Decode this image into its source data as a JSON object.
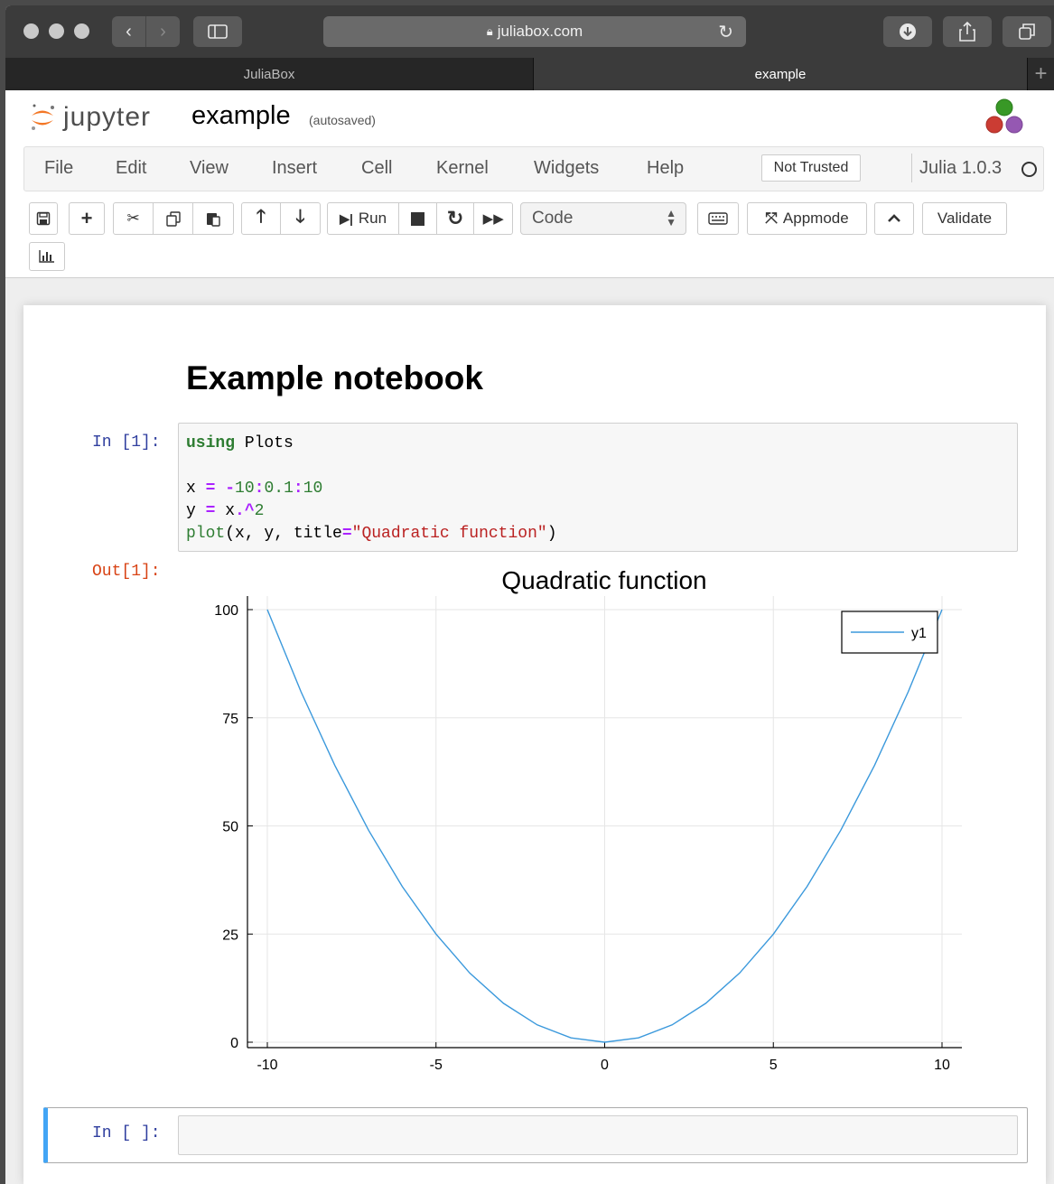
{
  "browser": {
    "address": "juliabox.com",
    "tabs": [
      {
        "label": "JuliaBox",
        "active": false
      },
      {
        "label": "example",
        "active": true
      }
    ]
  },
  "jupyter": {
    "logo_text": "jupyter",
    "notebook_name": "example",
    "autosave_status": "(autosaved)",
    "menu": [
      "File",
      "Edit",
      "View",
      "Insert",
      "Cell",
      "Kernel",
      "Widgets",
      "Help"
    ],
    "trust_status": "Not Trusted",
    "kernel_name": "Julia 1.0.3",
    "toolbar": {
      "run_label": "Run",
      "cell_type": "Code",
      "appmode_label": "Appmode",
      "validate_label": "Validate"
    }
  },
  "notebook": {
    "heading": "Example notebook",
    "cell1": {
      "prompt_in": "In [1]:",
      "prompt_out": "Out[1]:",
      "code_lines": [
        "using Plots",
        "",
        "x = -10:0.1:10",
        "y = x.^2",
        "plot(x, y, title=\"Quadratic function\")"
      ]
    },
    "cell2": {
      "prompt_in": "In [ ]:"
    }
  },
  "chart_data": {
    "type": "line",
    "title": "Quadratic function",
    "xlabel": "",
    "ylabel": "",
    "xlim": [
      -10,
      10
    ],
    "ylim": [
      0,
      100
    ],
    "x_ticks": [
      -10,
      -5,
      0,
      5,
      10
    ],
    "y_ticks": [
      0,
      25,
      50,
      75,
      100
    ],
    "grid": true,
    "legend": "top-right",
    "series": [
      {
        "name": "y1",
        "color": "#3b99dc",
        "x": [
          -10,
          -9,
          -8,
          -7,
          -6,
          -5,
          -4,
          -3,
          -2,
          -1,
          0,
          1,
          2,
          3,
          4,
          5,
          6,
          7,
          8,
          9,
          10
        ],
        "values": [
          100,
          81,
          64,
          49,
          36,
          25,
          16,
          9,
          4,
          1,
          0,
          1,
          4,
          9,
          16,
          25,
          36,
          49,
          64,
          81,
          100
        ]
      }
    ]
  }
}
